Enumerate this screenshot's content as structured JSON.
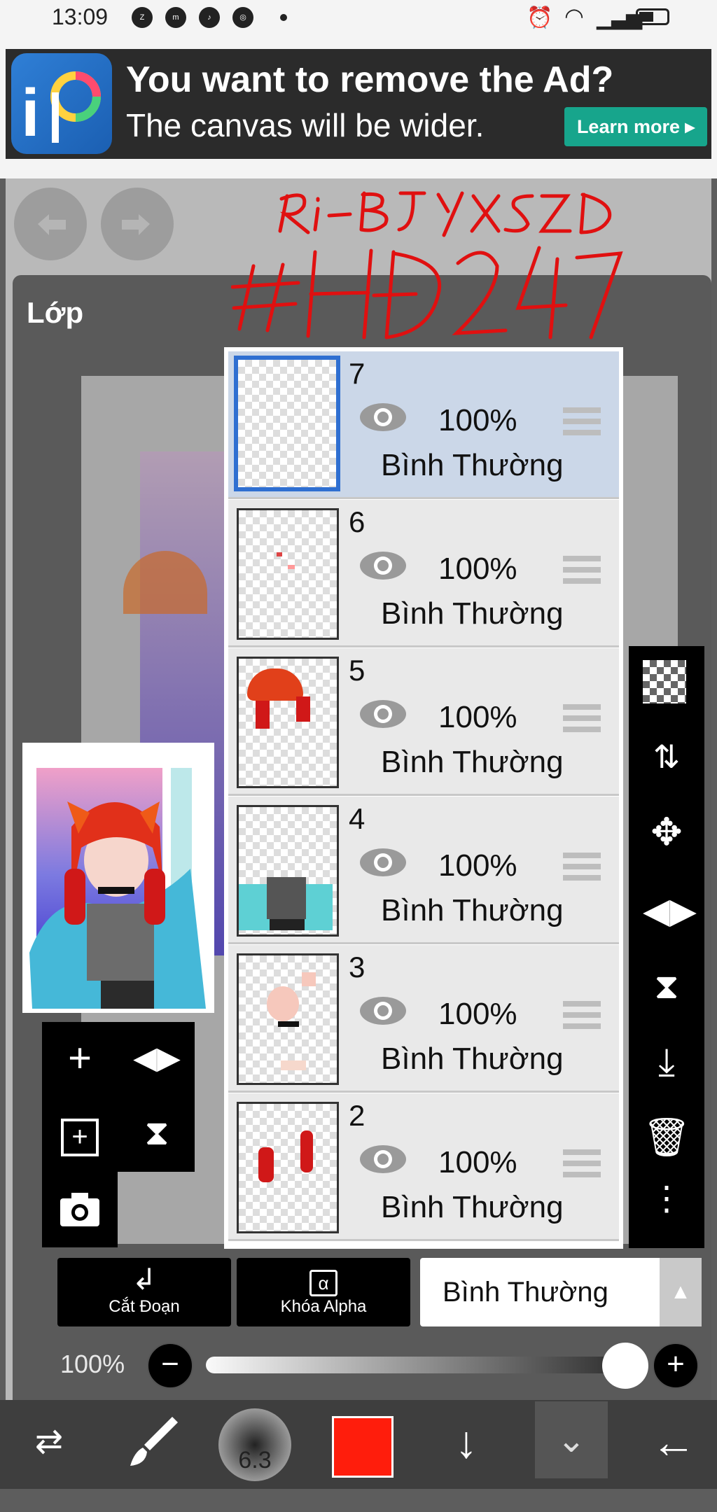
{
  "status_bar": {
    "time": "13:09",
    "app_icons": [
      "zalo-icon",
      "messenger-icon",
      "tiktok-icon",
      "chrome-icon"
    ],
    "battery": "low"
  },
  "ad": {
    "title": "You want to remove the Ad?",
    "subtitle": "The canvas will be wider.",
    "button": "Learn more ▸"
  },
  "watermark": {
    "line1": "Ri-BJYXSZD",
    "line2": "#HD247",
    "color": "#e01010"
  },
  "panel": {
    "title": "Lớp"
  },
  "layers": [
    {
      "number": "7",
      "opacity": "100%",
      "mode": "Bình Thường",
      "selected": true
    },
    {
      "number": "6",
      "opacity": "100%",
      "mode": "Bình Thường",
      "selected": false
    },
    {
      "number": "5",
      "opacity": "100%",
      "mode": "Bình Thường",
      "selected": false
    },
    {
      "number": "4",
      "opacity": "100%",
      "mode": "Bình Thường",
      "selected": false
    },
    {
      "number": "3",
      "opacity": "100%",
      "mode": "Bình Thường",
      "selected": false
    },
    {
      "number": "2",
      "opacity": "100%",
      "mode": "Bình Thường",
      "selected": false
    }
  ],
  "layer_tools": {
    "clip_label": "Cắt Đoạn",
    "alpha_lock_label": "Khóa Alpha",
    "alpha_icon_text": "α"
  },
  "blend_mode": {
    "selected": "Bình Thường"
  },
  "opacity": {
    "label": "100%",
    "value": 1.0
  },
  "brush": {
    "size": "6.3",
    "color": "#ff1d0c"
  },
  "colors": {
    "selection": "#2f6fd1",
    "accent": "#17a58c"
  }
}
